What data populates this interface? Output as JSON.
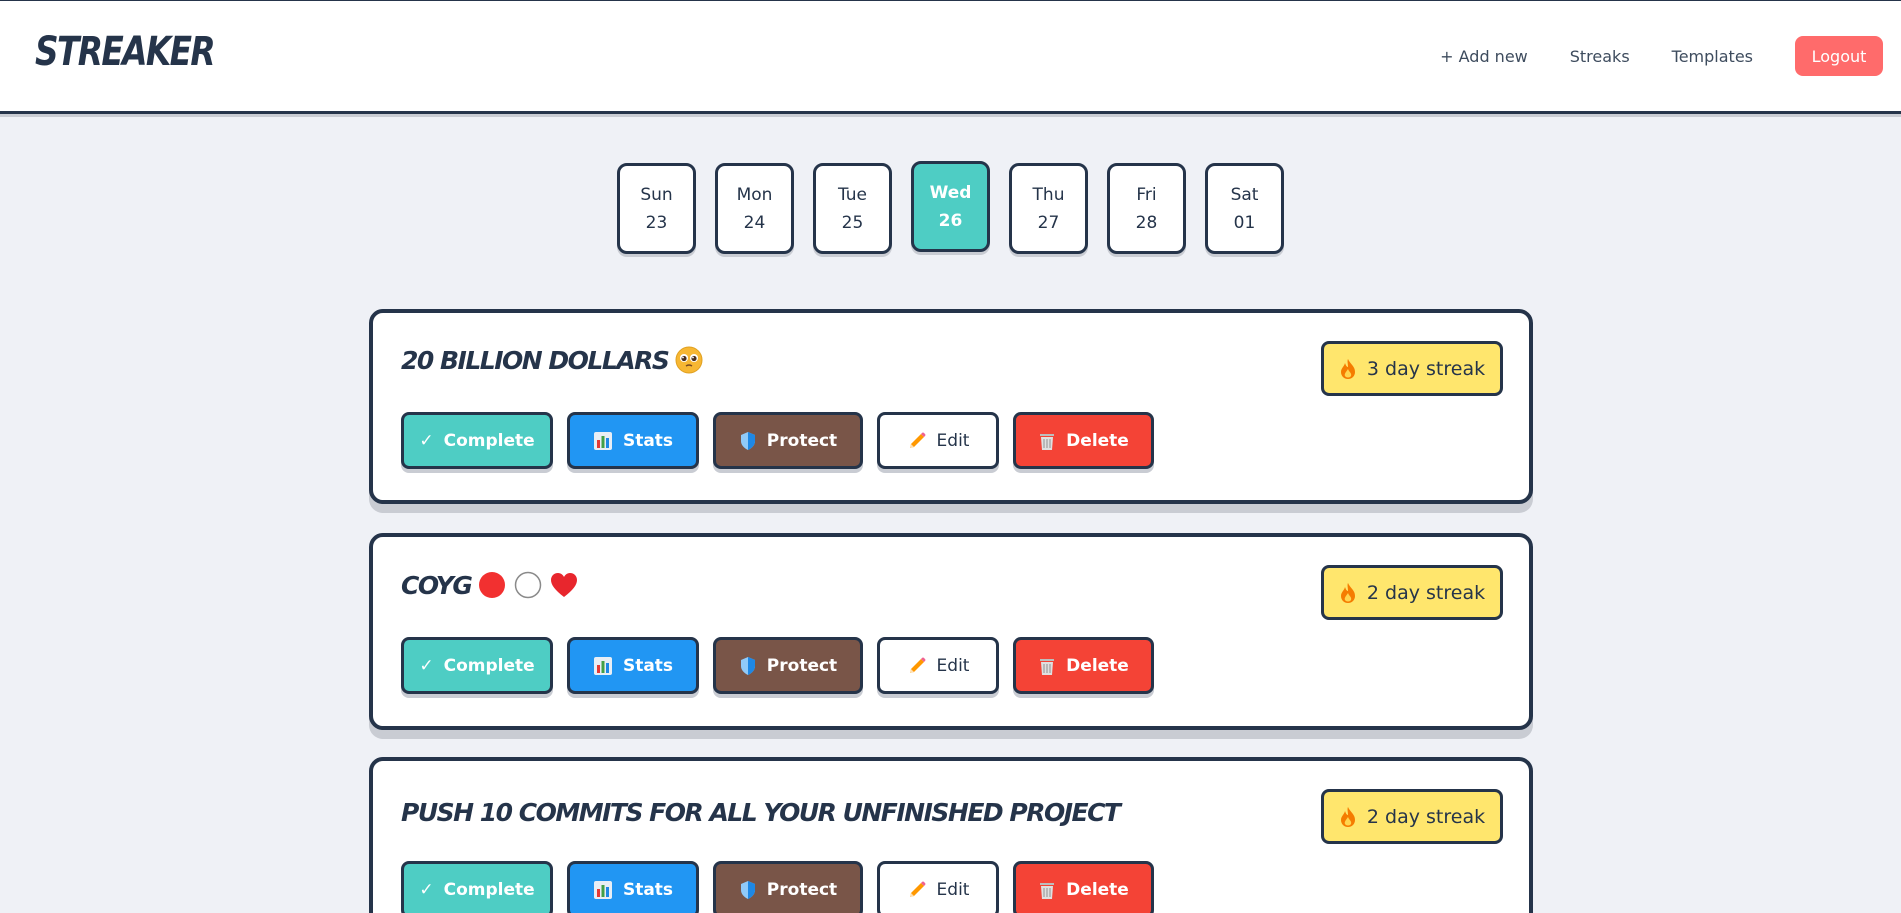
{
  "app": {
    "logo": "STREAKER"
  },
  "nav": {
    "add_new": "+ Add new",
    "streaks": "Streaks",
    "templates": "Templates",
    "logout": "Logout"
  },
  "days": [
    {
      "name": "Sun",
      "date": "23",
      "active": false
    },
    {
      "name": "Mon",
      "date": "24",
      "active": false
    },
    {
      "name": "Tue",
      "date": "25",
      "active": false
    },
    {
      "name": "Wed",
      "date": "26",
      "active": true
    },
    {
      "name": "Thu",
      "date": "27",
      "active": false
    },
    {
      "name": "Fri",
      "date": "28",
      "active": false
    },
    {
      "name": "Sat",
      "date": "01",
      "active": false
    }
  ],
  "actions": {
    "complete": "Complete",
    "stats": "Stats",
    "protect": "Protect",
    "edit": "Edit",
    "delete": "Delete"
  },
  "streaks": [
    {
      "title": "20 BILLION DOLLARS",
      "title_icons": [
        "pleading-face-icon"
      ],
      "streak_label": "3 day streak"
    },
    {
      "title": "COYG",
      "title_icons": [
        "red-circle-icon",
        "white-circle-icon",
        "red-heart-icon"
      ],
      "streak_label": "2 day streak"
    },
    {
      "title": "PUSH 10 COMMITS FOR ALL YOUR UNFINISHED PROJECT",
      "title_icons": [],
      "streak_label": "2 day streak"
    }
  ],
  "colors": {
    "accent_teal": "#4ecdc4",
    "stats_blue": "#2196f3",
    "protect_brown": "#795548",
    "delete_red": "#f44336",
    "logout_red": "#ff6b6b",
    "streak_yellow": "#ffe66d",
    "ink": "#25344a"
  }
}
